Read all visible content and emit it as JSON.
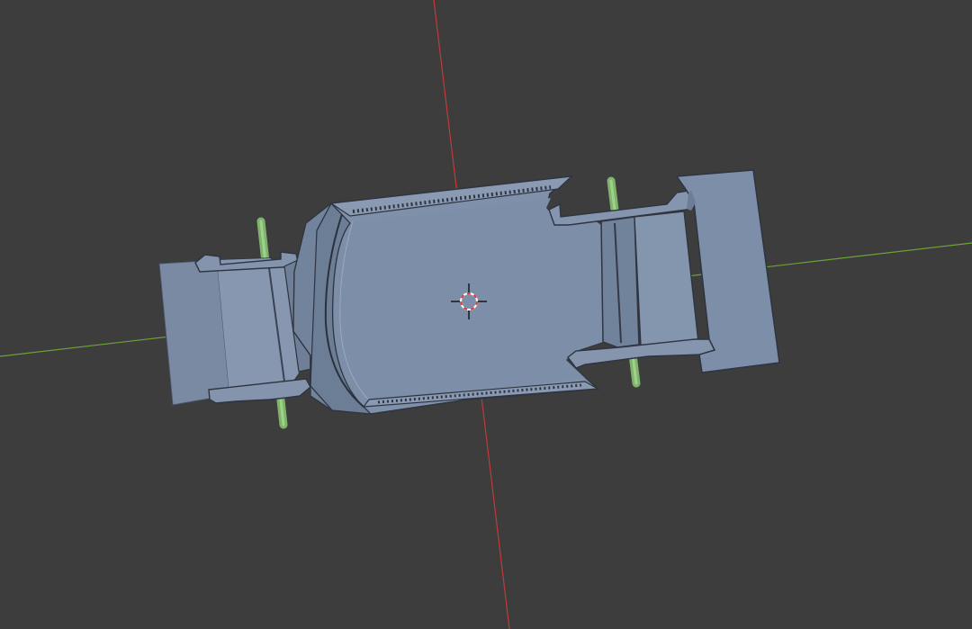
{
  "viewport": {
    "background": "#3d3d3d",
    "x_axis_color": "#6aa336",
    "y_axis_color": "#c23a3a"
  },
  "model": {
    "body_color": "#7d8ea8",
    "shade_color": "#6c7d96",
    "edge_color": "#2e3440",
    "axle_color": "#8fc47a"
  },
  "cursor": {
    "icon": "3d-cursor-icon",
    "ring_colors": [
      "#ffffff",
      "#d43c3c"
    ]
  }
}
